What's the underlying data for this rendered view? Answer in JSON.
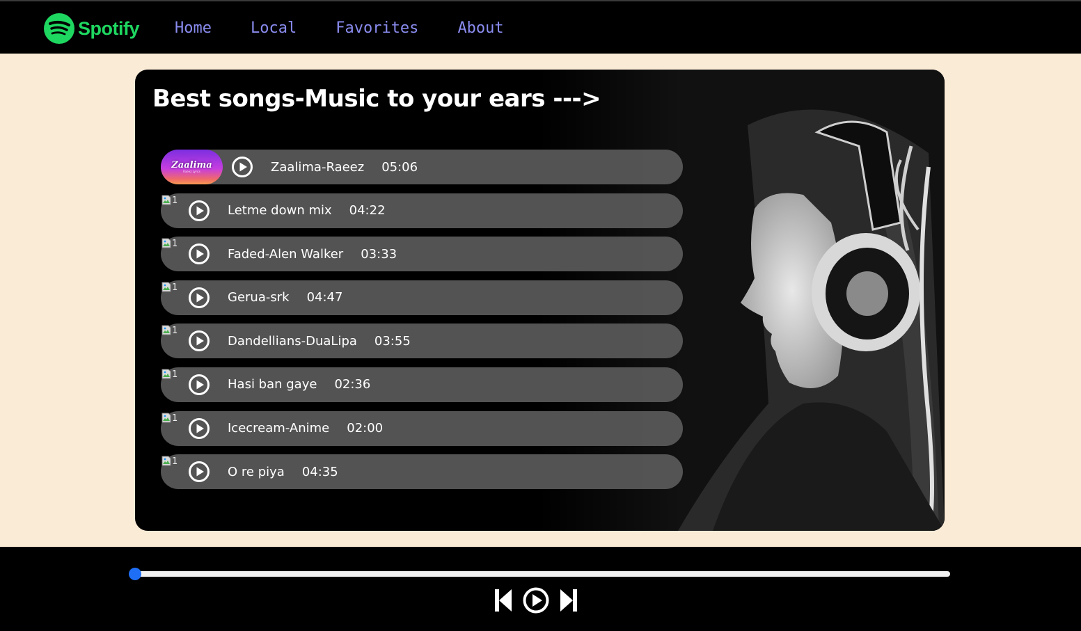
{
  "brand": {
    "name": "Spotify",
    "color": "#1ed760"
  },
  "nav": {
    "items": [
      {
        "label": "Home"
      },
      {
        "label": "Local"
      },
      {
        "label": "Favorites"
      },
      {
        "label": "About"
      }
    ]
  },
  "main": {
    "title": "Best songs-Music to your ears --->",
    "featured_cover": {
      "title": "Zaalima",
      "subtitle": "Raeez Lyrics"
    },
    "songs": [
      {
        "name": "Zaalima-Raeez",
        "duration": "05:06",
        "cover": "image"
      },
      {
        "name": "Letme down mix",
        "duration": "04:22",
        "cover_alt": "1"
      },
      {
        "name": "Faded-Alen Walker",
        "duration": "03:33",
        "cover_alt": "1"
      },
      {
        "name": "Gerua-srk",
        "duration": "04:47",
        "cover_alt": "1"
      },
      {
        "name": "Dandellians-DuaLipa",
        "duration": "03:55",
        "cover_alt": "1"
      },
      {
        "name": "Hasi ban gaye",
        "duration": "02:36",
        "cover_alt": "1"
      },
      {
        "name": "Icecream-Anime",
        "duration": "02:00",
        "cover_alt": "1"
      },
      {
        "name": "O re piya",
        "duration": "04:35",
        "cover_alt": "1"
      }
    ]
  },
  "player": {
    "progress": 0,
    "accent": "#1e6ff5",
    "controls": [
      "previous-icon",
      "play-icon",
      "next-icon"
    ]
  },
  "colors": {
    "page_bg": "#faebd7",
    "nav_link": "#8a8cf0",
    "song_row": "#5a5a5a"
  }
}
